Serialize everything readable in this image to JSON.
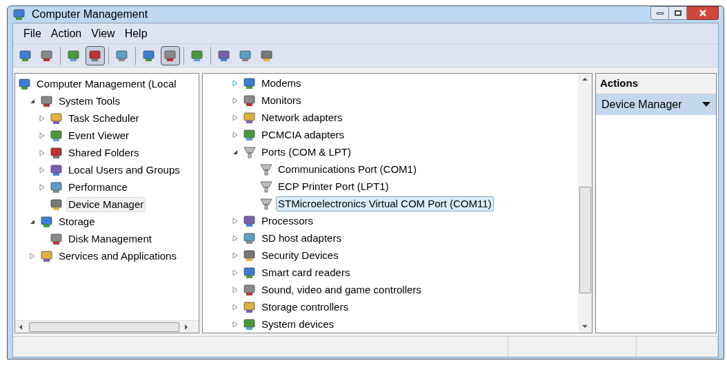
{
  "window": {
    "title": "Computer Management"
  },
  "menu": [
    {
      "label": "File"
    },
    {
      "label": "Action"
    },
    {
      "label": "View"
    },
    {
      "label": "Help"
    }
  ],
  "toolbar": [
    {
      "kind": "button",
      "pressed": false
    },
    {
      "kind": "button",
      "pressed": false
    },
    {
      "kind": "separator"
    },
    {
      "kind": "button",
      "pressed": false
    },
    {
      "kind": "button",
      "pressed": true
    },
    {
      "kind": "separator"
    },
    {
      "kind": "button",
      "pressed": false
    },
    {
      "kind": "separator"
    },
    {
      "kind": "button",
      "pressed": false
    },
    {
      "kind": "button",
      "pressed": true
    },
    {
      "kind": "separator"
    },
    {
      "kind": "button",
      "pressed": false
    },
    {
      "kind": "separator"
    },
    {
      "kind": "button",
      "pressed": false
    },
    {
      "kind": "button",
      "pressed": false
    },
    {
      "kind": "button",
      "pressed": false
    }
  ],
  "console_tree": [
    {
      "label": "Computer Management (Local",
      "selected": false,
      "children": [
        {
          "label": "System Tools",
          "expanded": true,
          "selected": false,
          "children": [
            {
              "label": "Task Scheduler",
              "expanded": false,
              "selected": false
            },
            {
              "label": "Event Viewer",
              "expanded": false,
              "selected": false
            },
            {
              "label": "Shared Folders",
              "expanded": false,
              "selected": false
            },
            {
              "label": "Local Users and Groups",
              "expanded": false,
              "selected": false
            },
            {
              "label": "Performance",
              "expanded": false,
              "selected": false
            },
            {
              "label": "Device Manager",
              "selected": true
            }
          ]
        },
        {
          "label": "Storage",
          "expanded": true,
          "selected": false,
          "children": [
            {
              "label": "Disk Management",
              "selected": false
            }
          ]
        },
        {
          "label": "Services and Applications",
          "expanded": false,
          "selected": false
        }
      ]
    }
  ],
  "device_tree": [
    {
      "label": "Modems",
      "expanded": false,
      "hovered": true,
      "selected": false
    },
    {
      "label": "Monitors",
      "expanded": false,
      "hovered": false,
      "selected": false
    },
    {
      "label": "Network adapters",
      "expanded": false,
      "hovered": false,
      "selected": false
    },
    {
      "label": "PCMCIA adapters",
      "expanded": false,
      "hovered": false,
      "selected": false
    },
    {
      "label": "Ports (COM & LPT)",
      "expanded": true,
      "hovered": false,
      "selected": false,
      "children": [
        {
          "label": "Communications Port (COM1)",
          "selected": false
        },
        {
          "label": "ECP Printer Port (LPT1)",
          "selected": false
        },
        {
          "label": "STMicroelectronics Virtual COM Port (COM11)",
          "selected": true
        }
      ]
    },
    {
      "label": "Processors",
      "expanded": false,
      "hovered": false,
      "selected": false
    },
    {
      "label": "SD host adapters",
      "expanded": false,
      "hovered": false,
      "selected": false
    },
    {
      "label": "Security Devices",
      "expanded": false,
      "hovered": false,
      "selected": false
    },
    {
      "label": "Smart card readers",
      "expanded": false,
      "hovered": false,
      "selected": false
    },
    {
      "label": "Sound, video and game controllers",
      "expanded": false,
      "hovered": false,
      "selected": false
    },
    {
      "label": "Storage controllers",
      "expanded": false,
      "hovered": false,
      "selected": false
    },
    {
      "label": "System devices",
      "expanded": false,
      "hovered": false,
      "selected": false
    }
  ],
  "actions": {
    "title": "Actions",
    "items": [
      {
        "label": "Device Manager"
      }
    ]
  }
}
